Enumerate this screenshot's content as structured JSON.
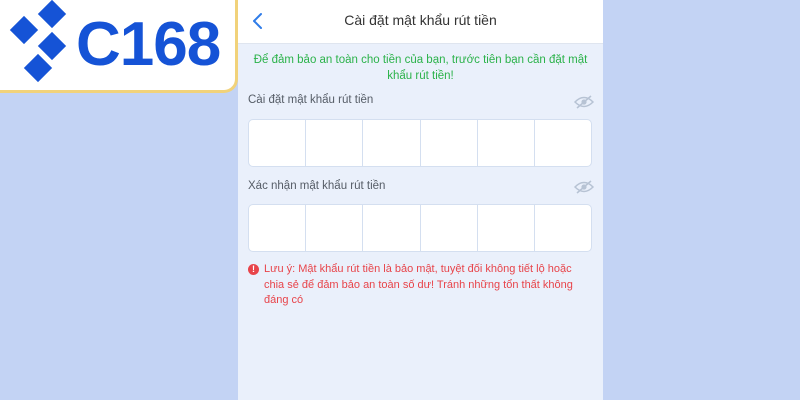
{
  "logo": {
    "text": "C168"
  },
  "header": {
    "title": "Cài đặt mật khẩu rút tiền"
  },
  "notice": "Để đảm bảo an toàn cho tiền của bạn, trước tiên bạn cần đặt mật khẩu rút tiền!",
  "fields": [
    {
      "label": "Cài đặt mật khẩu rút tiền",
      "digits": [
        "",
        "",
        "",
        "",
        "",
        ""
      ]
    },
    {
      "label": "Xác nhận mật khẩu rút tiền",
      "digits": [
        "",
        "",
        "",
        "",
        "",
        ""
      ]
    }
  ],
  "warning": {
    "icon": "exclamation",
    "text": "Lưu ý: Mật khẩu rút tiền là bảo mật, tuyệt đối không tiết lộ hoặc chia sẻ để đảm bảo an toàn số dư! Tránh những tổn thất không đáng có"
  },
  "icons": {
    "back": "chevron-left-icon",
    "eye": "eye-off-icon",
    "warn": "alert-circle-icon"
  },
  "colors": {
    "background": "#c3d3f4",
    "panel": "#eaf0fb",
    "brand": "#1553d6",
    "logo_border": "#f1d27a",
    "notice": "#2bb24a",
    "warning": "#e8444a",
    "back_arrow": "#2f7ce8"
  }
}
